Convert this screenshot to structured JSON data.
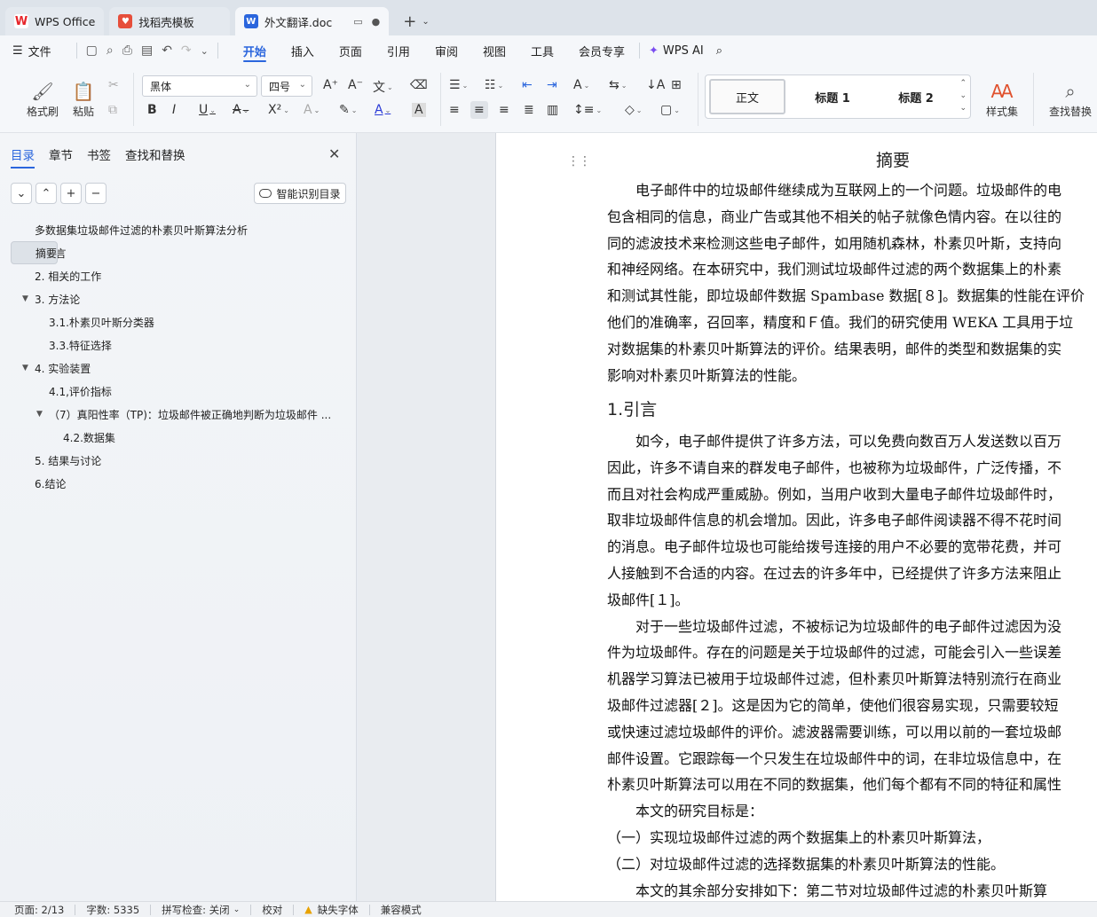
{
  "tabs": [
    {
      "label": "WPS Office",
      "icon": "wps-logo-icon"
    },
    {
      "label": "找稻壳模板",
      "icon": "docer-icon"
    },
    {
      "label": "外文翻译.doc",
      "icon": "word-doc-icon"
    }
  ],
  "menu": {
    "file": "文件",
    "items": [
      "开始",
      "插入",
      "页面",
      "引用",
      "审阅",
      "视图",
      "工具",
      "会员专享"
    ],
    "wps_ai": "WPS AI"
  },
  "ribbon": {
    "format_painter": "格式刷",
    "paste": "粘贴",
    "font": "黑体",
    "size": "四号",
    "styles": [
      "正文",
      "标题 1",
      "标题 2"
    ],
    "style_set": "样式集",
    "find_replace": "查找替换"
  },
  "nav": {
    "tabs": [
      "目录",
      "章节",
      "书签",
      "查找和替换"
    ],
    "smart_button": "智能识别目录",
    "toc": [
      {
        "label": "多数据集垃圾邮件过滤的朴素贝叶斯算法分析",
        "level": 0,
        "toggle": ""
      },
      {
        "label": "摘要",
        "level": 0,
        "toggle": "",
        "selected": true
      },
      {
        "label": "1.引言",
        "level": 1,
        "toggle": ""
      },
      {
        "label": "2. 相关的工作",
        "level": 1,
        "toggle": ""
      },
      {
        "label": "3. 方法论",
        "level": 1,
        "toggle": "▼"
      },
      {
        "label": "3.1.朴素贝叶斯分类器",
        "level": 2,
        "toggle": ""
      },
      {
        "label": "3.3.特征选择",
        "level": 2,
        "toggle": ""
      },
      {
        "label": "4. 实验装置",
        "level": 1,
        "toggle": "▼"
      },
      {
        "label": "4.1,评价指标",
        "level": 2,
        "toggle": ""
      },
      {
        "label": "（7）真阳性率（TP)：垃圾邮件被正确地判断为垃圾邮件 ...",
        "level": 2,
        "toggle": "▼"
      },
      {
        "label": "4.2.数据集",
        "level": 3,
        "toggle": ""
      },
      {
        "label": "5. 结果与讨论",
        "level": 1,
        "toggle": ""
      },
      {
        "label": "6.结论",
        "level": 1,
        "toggle": ""
      }
    ]
  },
  "document": {
    "title": "摘要",
    "abstract_lines": [
      "　　电子邮件中的垃圾邮件继续成为互联网上的一个问题。垃圾邮件的电",
      "包含相同的信息，商业广告或其他不相关的帖子就像色情内容。在以往的",
      "同的滤波技术来检测这些电子邮件，如用随机森林，朴素贝叶斯，支持向",
      "和神经网络。在本研究中，我们测试垃圾邮件过滤的两个数据集上的朴素",
      "和测试其性能，即垃圾邮件数据 Spambase 数据[８]。数据集的性能在评价",
      "他们的准确率，召回率，精度和Ｆ值。我们的研究使用 WEKA 工具用于垃",
      "对数据集的朴素贝叶斯算法的评价。结果表明，邮件的类型和数据集的实",
      "影响对朴素贝叶斯算法的性能。"
    ],
    "heading1": "1.引言",
    "intro_lines": [
      "　　如今，电子邮件提供了许多方法，可以免费向数百万人发送数以百万",
      "因此，许多不请自来的群发电子邮件，也被称为垃圾邮件，广泛传播，不",
      "而且对社会构成严重威胁。例如，当用户收到大量电子邮件垃圾邮件时，",
      "取非垃圾邮件信息的机会增加。因此，许多电子邮件阅读器不得不花时间",
      "的消息。电子邮件垃圾也可能给拨号连接的用户不必要的宽带花费，并可",
      "人接触到不合适的内容。在过去的许多年中，已经提供了许多方法来阻止",
      "圾邮件[１]。",
      "　　对于一些垃圾邮件过滤，不被标记为垃圾邮件的电子邮件过滤因为没",
      "件为垃圾邮件。存在的问题是关于垃圾邮件的过滤，可能会引入一些误差",
      "机器学习算法已被用于垃圾邮件过滤，但朴素贝叶斯算法特别流行在商业",
      "圾邮件过滤器[２]。这是因为它的简单，使他们很容易实现，只需要较短",
      "或快速过滤垃圾邮件的评价。滤波器需要训练，可以用以前的一套垃圾邮",
      "邮件设置。它跟踪每一个只发生在垃圾邮件中的词，在非垃圾信息中，在",
      "朴素贝叶斯算法可以用在不同的数据集，他们每个都有不同的特征和属性",
      "　　本文的研究目标是：",
      "（一）实现垃圾邮件过滤的两个数据集上的朴素贝叶斯算法，",
      "（二）对垃圾邮件过滤的选择数据集的朴素贝叶斯算法的性能。",
      "　　本文的其余部分安排如下：第二节对垃圾邮件过滤的朴素贝叶斯算"
    ]
  },
  "status": {
    "page": "页面: 2/13",
    "words": "字数: 5335",
    "spell": "拼写检查: 关闭",
    "proof": "校对",
    "missing_font": "缺失字体",
    "compat": "兼容模式"
  }
}
